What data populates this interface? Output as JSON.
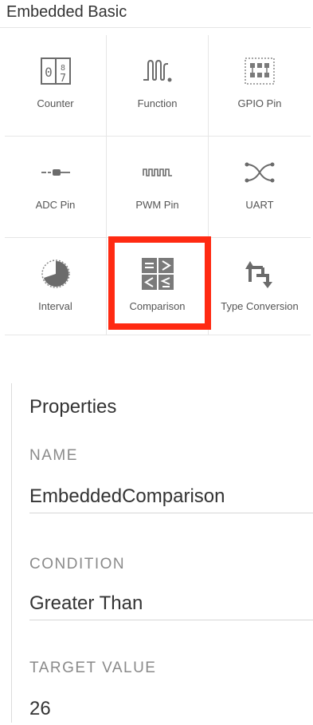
{
  "palette": {
    "title": "Embedded Basic",
    "tiles": [
      {
        "label": "Counter",
        "icon": "counter-icon"
      },
      {
        "label": "Function",
        "icon": "function-wave-icon"
      },
      {
        "label": "GPIO Pin",
        "icon": "gpio-pin-icon"
      },
      {
        "label": "ADC Pin",
        "icon": "adc-pin-icon"
      },
      {
        "label": "PWM Pin",
        "icon": "pwm-pin-icon"
      },
      {
        "label": "UART",
        "icon": "uart-icon"
      },
      {
        "label": "Interval",
        "icon": "interval-icon"
      },
      {
        "label": "Comparison",
        "icon": "comparison-icon"
      },
      {
        "label": "Type Conversion",
        "icon": "type-conversion-icon"
      }
    ],
    "selected_tile": "Comparison",
    "highlight_color": "#ff2a12"
  },
  "properties": {
    "title": "Properties",
    "fields": [
      {
        "label": "NAME",
        "value": "EmbeddedComparison"
      },
      {
        "label": "CONDITION",
        "value": "Greater Than"
      },
      {
        "label": "TARGET VALUE",
        "value": "26"
      }
    ]
  }
}
